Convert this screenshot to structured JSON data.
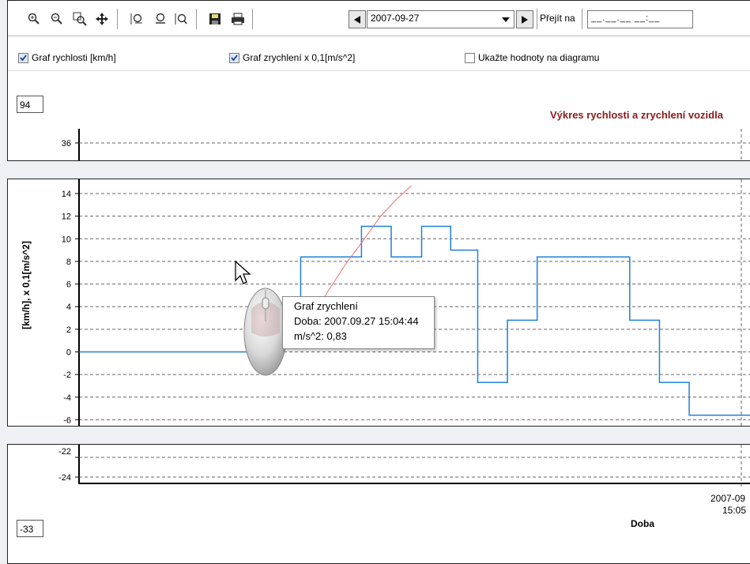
{
  "toolbar": {
    "icons": [
      "zoom-in",
      "zoom-out",
      "zoom-window",
      "pan",
      "zoom-vertical",
      "zoom-reset",
      "zoom-fit",
      "save",
      "print"
    ],
    "date_value": "2007-09-27",
    "goto_label": "Přejít na",
    "goto_value": "__.__.__ __:__"
  },
  "options": {
    "speed_label": "Graf rychlosti [km/h]",
    "speed_checked": true,
    "accel_label": "Graf zrychlení x 0,1[m/s^2]",
    "accel_checked": true,
    "values_label": "Ukažte hodnoty na diagramu",
    "values_checked": false
  },
  "top_value": "94",
  "bottom_value": "-33",
  "chart_title": "Výkres rychlosti a zrychlení vozidla",
  "tooltip": {
    "line1": "Graf zrychlení",
    "line2": "Doba: 2007.09.27 15:04:44",
    "line3": "m/s^2: 0,83"
  },
  "chart_data": {
    "type": "line",
    "ylabel": "[km/h],  x 0,1[m/s^2]",
    "xlabel": "Doba",
    "top_pane_ticks": [
      "36"
    ],
    "mid_pane_ticks": [
      "14",
      "12",
      "10",
      "8",
      "6",
      "4",
      "2",
      "0",
      "-2",
      "-4",
      "-6"
    ],
    "bottom_pane_ticks": [
      "-22",
      "-24"
    ],
    "x_tick_labels": [
      "2007-09",
      "15:05"
    ],
    "ylim": [
      -6,
      14.6
    ],
    "series": [
      {
        "color": "#1f7fd6",
        "step": true,
        "points": [
          [
            0,
            0
          ],
          [
            0.285,
            0
          ],
          [
            0.285,
            2.8
          ],
          [
            0.328,
            2.8
          ],
          [
            0.328,
            8.4
          ],
          [
            0.418,
            8.4
          ],
          [
            0.418,
            11.1
          ],
          [
            0.462,
            11.1
          ],
          [
            0.462,
            8.4
          ],
          [
            0.507,
            8.4
          ],
          [
            0.507,
            11.1
          ],
          [
            0.55,
            11.1
          ],
          [
            0.55,
            9
          ],
          [
            0.59,
            9
          ],
          [
            0.59,
            -2.7
          ],
          [
            0.634,
            -2.7
          ],
          [
            0.634,
            2.8
          ],
          [
            0.678,
            2.8
          ],
          [
            0.678,
            8.4
          ],
          [
            0.815,
            8.4
          ],
          [
            0.815,
            2.8
          ],
          [
            0.859,
            2.8
          ],
          [
            0.859,
            -2.7
          ],
          [
            0.903,
            -2.7
          ],
          [
            0.903,
            -5.6
          ],
          [
            1,
            -5.6
          ]
        ]
      },
      {
        "color": "#f26b6b",
        "step": false,
        "points": [
          [
            0.285,
            0
          ],
          [
            0.305,
            0.5
          ],
          [
            0.325,
            1.5
          ],
          [
            0.345,
            3.2
          ],
          [
            0.37,
            5.5
          ],
          [
            0.395,
            7.8
          ],
          [
            0.42,
            9.8
          ],
          [
            0.445,
            11.9
          ],
          [
            0.47,
            13.5
          ],
          [
            0.492,
            14.7
          ]
        ]
      }
    ]
  }
}
